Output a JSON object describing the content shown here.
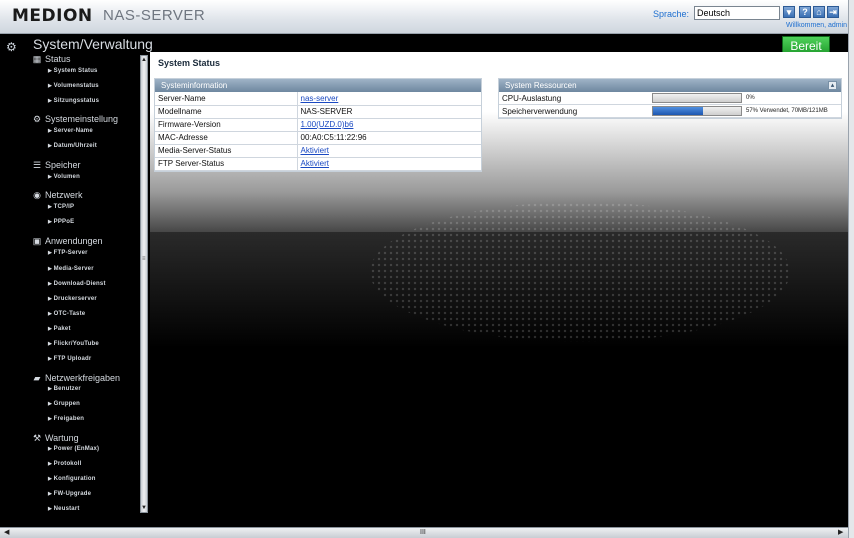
{
  "header": {
    "brand": "MEDION",
    "product": "NAS-SERVER",
    "language_label": "Sprache:",
    "language_value": "Deutsch",
    "welcome": "Willkommen, admin",
    "icons": [
      "help-icon",
      "home-icon",
      "logout-icon"
    ]
  },
  "page": {
    "title": "System/Verwaltung",
    "ready_label": "Bereit"
  },
  "sidebar": {
    "sections": [
      {
        "label": "Status",
        "icon": "status-icon",
        "items": [
          "System Status",
          "Volumenstatus",
          "Sitzungsstatus"
        ]
      },
      {
        "label": "Systemeinstellung",
        "icon": "gear-icon",
        "items": [
          "Server-Name",
          "Datum/Uhrzeit"
        ]
      },
      {
        "label": "Speicher",
        "icon": "storage-icon",
        "items": [
          "Volumen"
        ]
      },
      {
        "label": "Netzwerk",
        "icon": "globe-icon",
        "items": [
          "TCP/IP",
          "PPPoE"
        ]
      },
      {
        "label": "Anwendungen",
        "icon": "apps-icon",
        "items": [
          "FTP-Server",
          "Media-Server",
          "Download-Dienst",
          "Druckerserver",
          "OTC-Taste",
          "Paket",
          "Flickr/YouTube",
          "FTP Uploadr"
        ]
      },
      {
        "label": "Netzwerkfreigaben",
        "icon": "folder-icon",
        "items": [
          "Benutzer",
          "Gruppen",
          "Freigaben"
        ]
      },
      {
        "label": "Wartung",
        "icon": "wrench-icon",
        "items": [
          "Power (EnMax)",
          "Protokoll",
          "Konfiguration",
          "FW-Upgrade",
          "Neustart"
        ]
      }
    ]
  },
  "main": {
    "section_title": "System Status",
    "systeminfo": {
      "title": "Systeminformation",
      "rows": [
        {
          "label": "Server-Name",
          "value": "nas-server",
          "link": true
        },
        {
          "label": "Modellname",
          "value": "NAS-SERVER",
          "link": false
        },
        {
          "label": "Firmware-Version",
          "value": "1.00(UZD.0)b6",
          "link": true
        },
        {
          "label": "MAC-Adresse",
          "value": "00:A0:C5:11:22:96",
          "link": false
        },
        {
          "label": "Media-Server-Status",
          "value": "Aktiviert",
          "link": true
        },
        {
          "label": "FTP Server-Status",
          "value": "Aktiviert",
          "link": true
        }
      ]
    },
    "resources": {
      "title": "System Ressourcen",
      "collapse_icon": "collapse-icon",
      "rows": [
        {
          "label": "CPU-Auslastung",
          "percent": 0,
          "value_text": "0%"
        },
        {
          "label": "Speicherverwendung",
          "percent": 57,
          "value_text": "57% Verwendet, 70MB/121MB"
        }
      ]
    }
  },
  "scroll": {
    "bottom_grip": "III"
  },
  "colors": {
    "accent_green": "#1e9a2a",
    "panel_header": "#6e879f",
    "link": "#1a49c2"
  }
}
